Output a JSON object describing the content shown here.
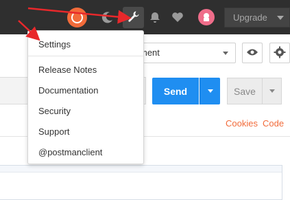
{
  "header": {
    "icons": [
      "sync-icon",
      "satellite-icon",
      "wrench-icon",
      "bell-icon",
      "heart-icon",
      "avatar-icon"
    ],
    "upgrade_label": "Upgrade"
  },
  "environment": {
    "selected_value": "ment"
  },
  "request": {
    "send_label": "Send",
    "save_label": "Save"
  },
  "response_links": {
    "cookies_label": "Cookies",
    "code_label": "Code"
  },
  "settings_menu": {
    "items": [
      "Settings",
      "Release Notes",
      "Documentation",
      "Security",
      "Support",
      "@postmanclient"
    ]
  },
  "colors": {
    "accent": "#f26b3a",
    "send_blue": "#1f8ef1",
    "annotation_red": "#e8282b",
    "topbar_bg": "#2f2f2f"
  }
}
